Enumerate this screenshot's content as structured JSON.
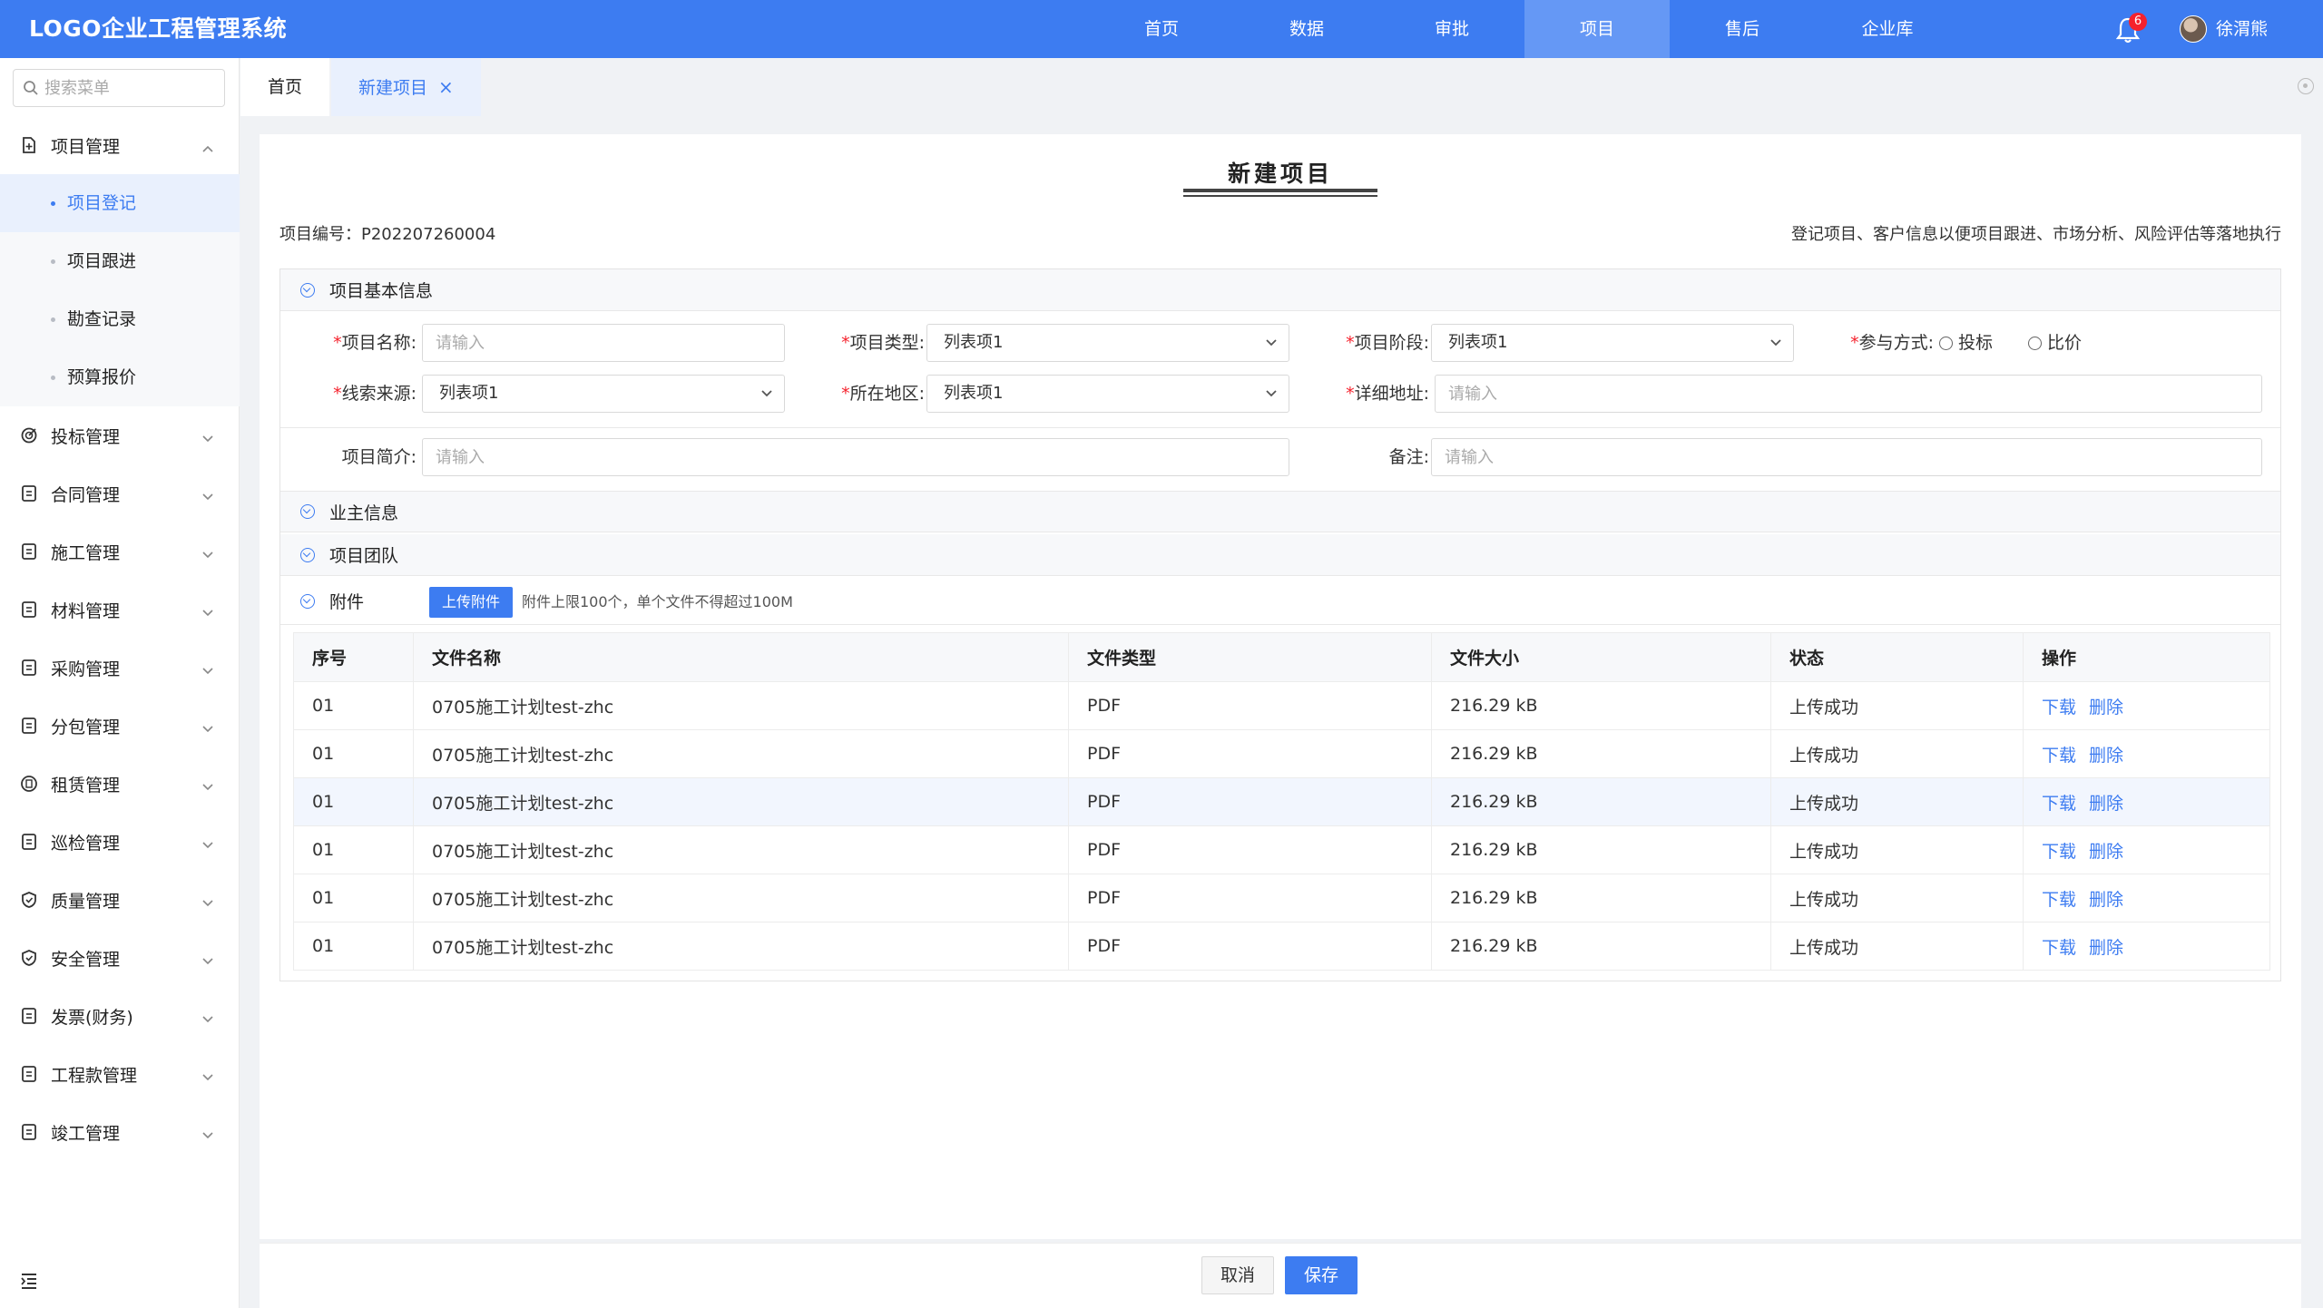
{
  "app": {
    "title": "LOGO企业工程管理系统"
  },
  "topnav": {
    "items": [
      "首页",
      "数据",
      "审批",
      "项目",
      "售后",
      "企业库"
    ],
    "active_index": 3,
    "notification_count": "6",
    "user_name": "徐渭熊"
  },
  "colors": {
    "primary": "#3d7cf1",
    "success": "#52c41a",
    "danger": "#f5222d"
  },
  "sidebar": {
    "search_placeholder": "搜索菜单",
    "menu": [
      {
        "label": "项目管理",
        "icon": "file-plus-icon",
        "expanded": true,
        "children": [
          "项目登记",
          "项目跟进",
          "勘查记录",
          "预算报价"
        ],
        "active_child": 0
      },
      {
        "label": "投标管理",
        "icon": "target-icon"
      },
      {
        "label": "合同管理",
        "icon": "contract-icon"
      },
      {
        "label": "施工管理",
        "icon": "construction-icon"
      },
      {
        "label": "材料管理",
        "icon": "material-icon"
      },
      {
        "label": "采购管理",
        "icon": "purchase-icon"
      },
      {
        "label": "分包管理",
        "icon": "subcontract-icon"
      },
      {
        "label": "租赁管理",
        "icon": "lease-icon"
      },
      {
        "label": "巡检管理",
        "icon": "inspection-icon"
      },
      {
        "label": "质量管理",
        "icon": "quality-shield-icon"
      },
      {
        "label": "安全管理",
        "icon": "safety-shield-icon"
      },
      {
        "label": "发票(财务)",
        "icon": "invoice-icon"
      },
      {
        "label": "工程款管理",
        "icon": "payment-icon"
      },
      {
        "label": "竣工管理",
        "icon": "completion-icon"
      }
    ]
  },
  "tabs": {
    "home": "首页",
    "current": "新建项目",
    "close": "×"
  },
  "form": {
    "title": "新建项目",
    "project_no": "项目编号：P202207260004",
    "description": "登记项目、客户信息以便项目跟进、市场分析、风险评估等落地执行",
    "sections": {
      "basic": "项目基本信息",
      "owner": "业主信息",
      "team": "项目团队",
      "attachment": "附件"
    },
    "fields": {
      "req_mark": "*",
      "name_label": "项目名称:",
      "name_placeholder": "请输入",
      "type_label": "项目类型:",
      "type_value": "列表项1",
      "stage_label": "项目阶段:",
      "stage_value": "列表项1",
      "participation_label": "参与方式:",
      "participation_options": [
        "投标",
        "比价"
      ],
      "source_label": "线索来源:",
      "source_value": "列表项1",
      "region_label": "所在地区:",
      "region_value": "列表项1",
      "address_label": "详细地址:",
      "address_placeholder": "请输入",
      "summary_label": "项目简介:",
      "summary_placeholder": "请输入",
      "remark_label": "备注:",
      "remark_placeholder": "请输入"
    },
    "upload": {
      "button": "上传附件",
      "hint": "附件上限100个，单个文件不得超过100M"
    },
    "table": {
      "headers": [
        "序号",
        "文件名称",
        "文件类型",
        "文件大小",
        "状态",
        "操作"
      ],
      "rows": [
        {
          "no": "01",
          "name": "0705施工计划test-zhc",
          "type": "PDF",
          "size": "216.29 kB",
          "status": "上传成功"
        },
        {
          "no": "01",
          "name": "0705施工计划test-zhc",
          "type": "PDF",
          "size": "216.29 kB",
          "status": "上传成功"
        },
        {
          "no": "01",
          "name": "0705施工计划test-zhc",
          "type": "PDF",
          "size": "216.29 kB",
          "status": "上传成功"
        },
        {
          "no": "01",
          "name": "0705施工计划test-zhc",
          "type": "PDF",
          "size": "216.29 kB",
          "status": "上传成功"
        },
        {
          "no": "01",
          "name": "0705施工计划test-zhc",
          "type": "PDF",
          "size": "216.29 kB",
          "status": "上传成功"
        },
        {
          "no": "01",
          "name": "0705施工计划test-zhc",
          "type": "PDF",
          "size": "216.29 kB",
          "status": "上传成功"
        }
      ],
      "highlighted_row": 2,
      "actions": [
        "下载",
        "删除"
      ]
    }
  },
  "footer": {
    "cancel": "取消",
    "save": "保存"
  }
}
